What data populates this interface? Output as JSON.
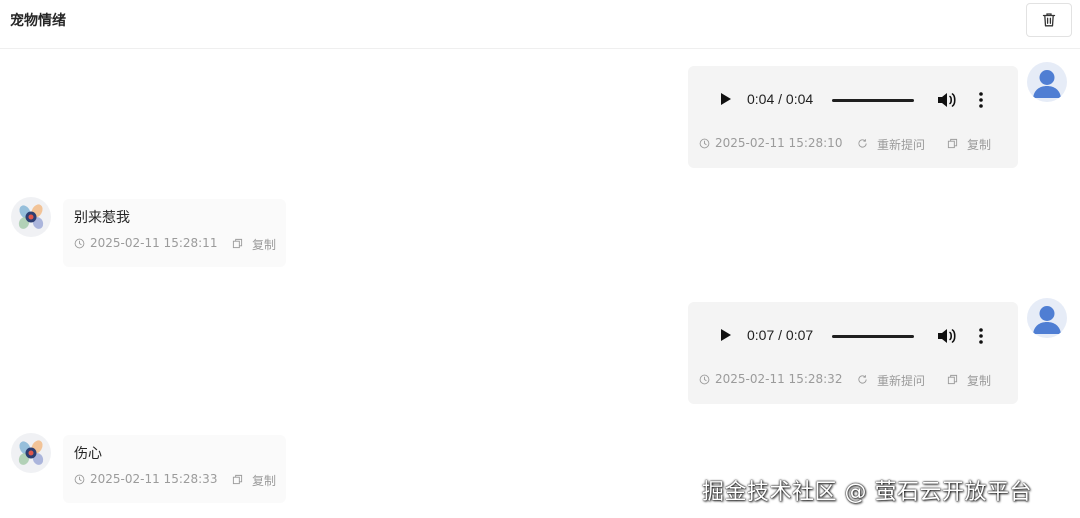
{
  "header": {
    "title": "宠物情绪",
    "clear_icon": "trash-icon"
  },
  "messages": [
    {
      "role": "user",
      "type": "audio",
      "audio_time": "0:04 / 0:04",
      "audio_progress": 1.0,
      "timestamp": "2025-02-11 15:28:10",
      "regenerate_label": "重新提问",
      "copy_label": "复制"
    },
    {
      "role": "bot",
      "type": "text",
      "text": "别来惹我",
      "timestamp": "2025-02-11 15:28:11",
      "copy_label": "复制"
    },
    {
      "role": "user",
      "type": "audio",
      "audio_time": "0:07 / 0:07",
      "audio_progress": 1.0,
      "timestamp": "2025-02-11 15:28:32",
      "regenerate_label": "重新提问",
      "copy_label": "复制"
    },
    {
      "role": "bot",
      "type": "text",
      "text": "伤心",
      "timestamp": "2025-02-11 15:28:33",
      "copy_label": "复制"
    }
  ],
  "watermark": "掘金技术社区 @ 萤石云开放平台",
  "colors": {
    "user_bubble": "#f4f4f4",
    "bot_bubble": "#fafafa",
    "user_avatar": "#4f7ed3",
    "meta_text": "#9b9b9b"
  },
  "icons": {
    "play": "play-icon",
    "volume": "volume-icon",
    "more": "more-vertical-icon",
    "clock": "clock-icon",
    "refresh": "refresh-icon",
    "copy": "copy-icon"
  }
}
